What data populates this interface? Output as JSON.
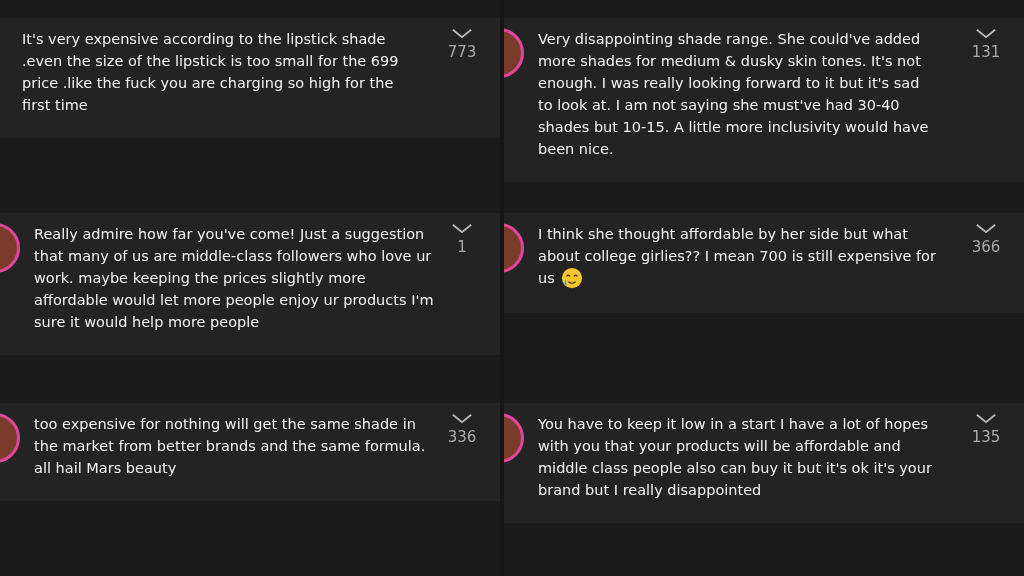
{
  "comments": [
    {
      "avatar": false,
      "text": "It's very expensive according to the lipstick shade .even the size of the lipstick is too small for the 699 price .like the fuck you are charging so high for the first time",
      "emoji": false,
      "count": "773"
    },
    {
      "avatar": true,
      "text": "Very disappointing shade range. She could've added more shades for medium & dusky skin tones. It's not enough. I was really looking forward to it but it's sad to look at. I am not saying she must've had 30-40 shades but 10-15. A little more inclusivity would have been nice.",
      "emoji": false,
      "count": "131"
    },
    {
      "avatar": true,
      "text": "Really admire how far you've come! Just a suggestion  that many of us are middle-class followers who love ur work. maybe keeping the prices slightly more affordable would let more people enjoy ur products I'm sure it would help more people",
      "emoji": false,
      "count": "1"
    },
    {
      "avatar": true,
      "text": "I think she thought affordable by her side but what about college girlies?? I mean 700 is still expensive for us",
      "emoji": true,
      "count": "366"
    },
    {
      "avatar": true,
      "text": "too expensive for nothing will get the same shade in the market from better brands and the same formula. all hail Mars beauty",
      "emoji": false,
      "count": "336"
    },
    {
      "avatar": true,
      "text": "You have to keep it low in a start I have a lot of hopes with you that your products will be affordable and middle class people also can buy it but it's ok it's your brand but I really disappointed",
      "emoji": false,
      "count": "135"
    }
  ]
}
